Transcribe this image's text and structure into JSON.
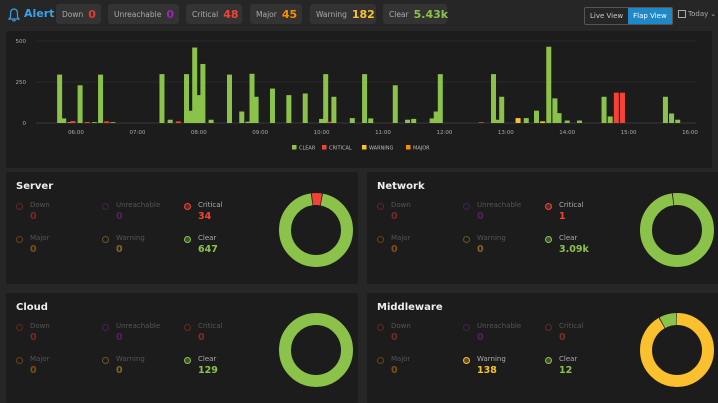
{
  "header": {
    "title": "Alert",
    "stats": [
      {
        "label": "Down",
        "value": "0",
        "color": "#e53935"
      },
      {
        "label": "Unreachable",
        "value": "0",
        "color": "#9c27b0"
      },
      {
        "label": "Critical",
        "value": "48",
        "color": "#f44336"
      },
      {
        "label": "Major",
        "value": "45",
        "color": "#fb8c00"
      },
      {
        "label": "Warning",
        "value": "182",
        "color": "#fbc02d"
      },
      {
        "label": "Clear",
        "value": "5.43k",
        "color": "#8bc34a"
      }
    ],
    "live_view_label": "Live View",
    "flap_view_label": "Flap View",
    "range_label": "Today"
  },
  "chart_data": {
    "type": "bar",
    "y_ticks": [
      "500",
      "250",
      "0"
    ],
    "ylim": [
      0,
      500
    ],
    "x_ticks": [
      "06:00",
      "07:00",
      "08:00",
      "09:00",
      "10:00",
      "11:00",
      "12:00",
      "13:00",
      "14:00",
      "15:00",
      "16:00"
    ],
    "legend": [
      {
        "name": "CLEAR",
        "color": "#8bc34a"
      },
      {
        "name": "CRITICAL",
        "color": "#f44336"
      },
      {
        "name": "WARNING",
        "color": "#fbc02d"
      },
      {
        "name": "MAJOR",
        "color": "#fb8c00"
      }
    ],
    "bars": [
      {
        "x": "05:44",
        "clear": 295
      },
      {
        "x": "05:48",
        "clear": 28
      },
      {
        "x": "05:54",
        "clear": 5
      },
      {
        "x": "05:57",
        "critical": 12
      },
      {
        "x": "06:04",
        "clear": 230
      },
      {
        "x": "06:11",
        "critical": 6
      },
      {
        "x": "06:18",
        "clear": 5
      },
      {
        "x": "06:24",
        "clear": 295
      },
      {
        "x": "06:30",
        "critical": 10
      },
      {
        "x": "06:36",
        "clear": 5
      },
      {
        "x": "07:24",
        "clear": 298
      },
      {
        "x": "07:32",
        "clear": 20
      },
      {
        "x": "07:40",
        "critical": 10
      },
      {
        "x": "07:48",
        "clear": 298
      },
      {
        "x": "07:52",
        "clear": 75
      },
      {
        "x": "07:56",
        "clear": 460
      },
      {
        "x": "08:00",
        "clear": 170
      },
      {
        "x": "08:04",
        "clear": 360
      },
      {
        "x": "08:12",
        "clear": 20
      },
      {
        "x": "08:30",
        "clear": 295
      },
      {
        "x": "08:42",
        "clear": 70
      },
      {
        "x": "08:48",
        "clear": 8
      },
      {
        "x": "08:52",
        "clear": 300
      },
      {
        "x": "08:56",
        "clear": 160
      },
      {
        "x": "09:12",
        "clear": 210
      },
      {
        "x": "09:28",
        "clear": 170
      },
      {
        "x": "09:44",
        "clear": 180
      },
      {
        "x": "10:00",
        "clear": 25
      },
      {
        "x": "10:04",
        "clear": 298
      },
      {
        "x": "10:08",
        "critical": 8
      },
      {
        "x": "10:12",
        "clear": 160
      },
      {
        "x": "10:30",
        "clear": 30
      },
      {
        "x": "10:42",
        "clear": 298
      },
      {
        "x": "10:48",
        "clear": 28
      },
      {
        "x": "11:12",
        "clear": 230
      },
      {
        "x": "11:24",
        "clear": 20
      },
      {
        "x": "11:30",
        "clear": 25
      },
      {
        "x": "11:48",
        "clear": 28
      },
      {
        "x": "11:52",
        "clear": 70
      },
      {
        "x": "11:56",
        "clear": 298
      },
      {
        "x": "12:36",
        "critical": 5
      },
      {
        "x": "12:48",
        "clear": 298
      },
      {
        "x": "12:52",
        "clear": 20
      },
      {
        "x": "12:56",
        "clear": 160
      },
      {
        "x": "13:12",
        "warning": 30
      },
      {
        "x": "13:20",
        "clear": 30
      },
      {
        "x": "13:30",
        "clear": 75
      },
      {
        "x": "13:36",
        "warning": 10
      },
      {
        "x": "13:42",
        "clear": 465
      },
      {
        "x": "13:48",
        "clear": 150
      },
      {
        "x": "13:52",
        "clear": 60
      },
      {
        "x": "14:00",
        "clear": 15
      },
      {
        "x": "14:12",
        "clear": 15
      },
      {
        "x": "14:36",
        "clear": 160
      },
      {
        "x": "14:42",
        "clear": 40
      },
      {
        "x": "14:48",
        "critical": 185
      },
      {
        "x": "14:54",
        "critical": 185
      },
      {
        "x": "15:36",
        "clear": 160
      },
      {
        "x": "15:42",
        "clear": 58
      },
      {
        "x": "15:48",
        "clear": 20
      }
    ]
  },
  "cards": [
    {
      "title": "Server",
      "metrics": [
        {
          "label": "Down",
          "value": "0",
          "color": "#e53935",
          "active": false
        },
        {
          "label": "Unreachable",
          "value": "0",
          "color": "#9c27b0",
          "active": false
        },
        {
          "label": "Critical",
          "value": "34",
          "color": "#f44336",
          "active": true
        },
        {
          "label": "Major",
          "value": "0",
          "color": "#fb8c00",
          "active": false
        },
        {
          "label": "Warning",
          "value": "0",
          "color": "#fbc02d",
          "active": false
        },
        {
          "label": "Clear",
          "value": "647",
          "color": "#8bc34a",
          "active": true
        }
      ],
      "donut": {
        "clear": 647,
        "critical": 34,
        "warning": 0,
        "major": 0
      }
    },
    {
      "title": "Network",
      "metrics": [
        {
          "label": "Down",
          "value": "0",
          "color": "#e53935",
          "active": false
        },
        {
          "label": "Unreachable",
          "value": "0",
          "color": "#9c27b0",
          "active": false
        },
        {
          "label": "Critical",
          "value": "1",
          "color": "#f44336",
          "active": true
        },
        {
          "label": "Major",
          "value": "0",
          "color": "#fb8c00",
          "active": false
        },
        {
          "label": "Warning",
          "value": "0",
          "color": "#fbc02d",
          "active": false
        },
        {
          "label": "Clear",
          "value": "3.09k",
          "color": "#8bc34a",
          "active": true
        }
      ],
      "donut": {
        "clear": 3090,
        "critical": 1,
        "warning": 0,
        "major": 0
      }
    },
    {
      "title": "Cloud",
      "metrics": [
        {
          "label": "Down",
          "value": "0",
          "color": "#e53935",
          "active": false
        },
        {
          "label": "Unreachable",
          "value": "0",
          "color": "#9c27b0",
          "active": false
        },
        {
          "label": "Critical",
          "value": "0",
          "color": "#f44336",
          "active": false
        },
        {
          "label": "Major",
          "value": "0",
          "color": "#fb8c00",
          "active": false
        },
        {
          "label": "Warning",
          "value": "0",
          "color": "#fbc02d",
          "active": false
        },
        {
          "label": "Clear",
          "value": "129",
          "color": "#8bc34a",
          "active": true
        }
      ],
      "donut": {
        "clear": 129,
        "critical": 0,
        "warning": 0,
        "major": 0
      }
    },
    {
      "title": "Middleware",
      "metrics": [
        {
          "label": "Down",
          "value": "0",
          "color": "#e53935",
          "active": false
        },
        {
          "label": "Unreachable",
          "value": "0",
          "color": "#9c27b0",
          "active": false
        },
        {
          "label": "Critical",
          "value": "0",
          "color": "#f44336",
          "active": false
        },
        {
          "label": "Major",
          "value": "0",
          "color": "#fb8c00",
          "active": false
        },
        {
          "label": "Warning",
          "value": "138",
          "color": "#fbc02d",
          "active": true
        },
        {
          "label": "Clear",
          "value": "12",
          "color": "#8bc34a",
          "active": true
        }
      ],
      "donut": {
        "clear": 12,
        "critical": 0,
        "warning": 138,
        "major": 0
      }
    }
  ]
}
